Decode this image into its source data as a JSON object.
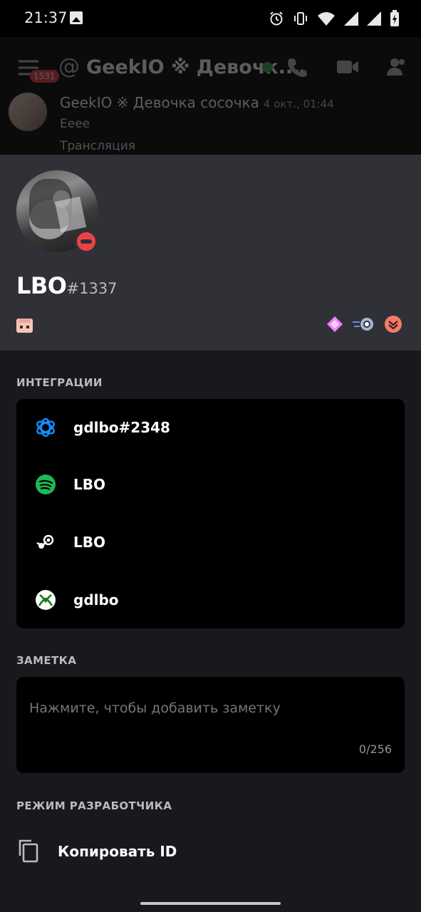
{
  "status_bar": {
    "time": "21:37",
    "icons": [
      "image-icon",
      "alarm-icon",
      "vibrate-icon",
      "wifi-icon",
      "signal-icon",
      "signal-icon",
      "battery-charging-icon"
    ]
  },
  "background_chat": {
    "unread_badge": "1531",
    "at_symbol": "@",
    "channel_title": "GeekIO ※ Девочк...",
    "message": {
      "author": "GeekIO ※ Девочка сосочка",
      "timestamp": "4 окт., 01:44",
      "lines": [
        "Еeee",
        "Трансляция"
      ]
    }
  },
  "profile": {
    "username": "LBO",
    "discriminator": "#1337",
    "status": "do-not-disturb",
    "badges": [
      "hypesquad-brilliance-icon",
      "early-supporter-icon",
      "nitro-boost-icon"
    ]
  },
  "integrations": {
    "title": "ИНТЕГРАЦИИ",
    "items": [
      {
        "service": "battlenet-icon",
        "label": "gdlbo#2348"
      },
      {
        "service": "spotify-icon",
        "label": "LBO"
      },
      {
        "service": "steam-icon",
        "label": "LBO"
      },
      {
        "service": "xbox-icon",
        "label": "gdlbo"
      }
    ]
  },
  "note": {
    "title": "ЗАМЕТКА",
    "placeholder": "Нажмите, чтобы добавить заметку",
    "counter": "0/256"
  },
  "developer": {
    "title": "РЕЖИМ РАЗРАБОТЧИКА",
    "copy_id_label": "Копировать ID"
  },
  "colors": {
    "sheet_background": "#18191c",
    "header_background": "#2f3136",
    "card_background": "#000000",
    "dnd_red": "#ed4245",
    "spotify_green": "#1db954",
    "xbox_green": "#107c10",
    "battlenet_blue": "#148eff"
  }
}
